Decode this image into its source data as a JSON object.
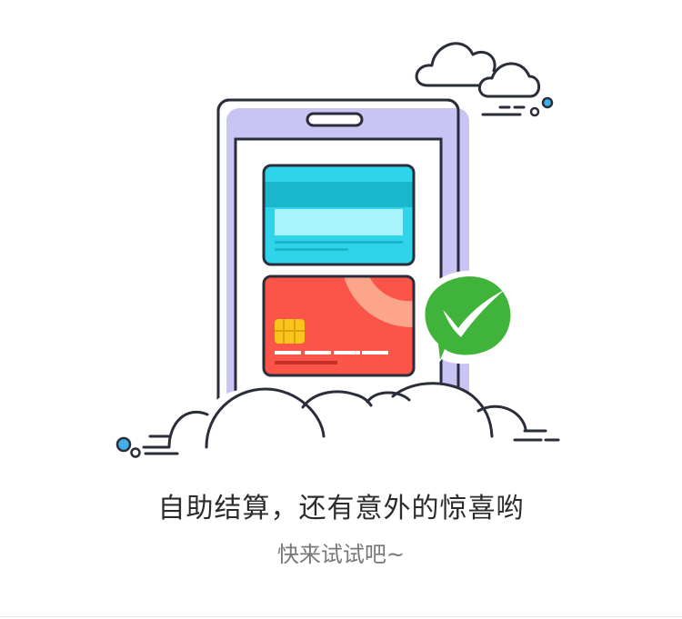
{
  "promo": {
    "headline": "自助结算，还有意外的惊喜哟",
    "subline": "快来试试吧~"
  },
  "colors": {
    "outline": "#2a2d3a",
    "phone_frame": "#c8c4f4",
    "card_cyan": "#2fd4ea",
    "card_cyan_stripe": "#1ab7cc",
    "card_cyan_panel": "#a8f4fc",
    "card_red": "#fb5448",
    "card_red_arc": "#fca58a",
    "chip": "#f7c51b",
    "wechat_green": "#3fb33a",
    "dot_blue": "#42b0e8",
    "headline_text": "#2b2b2b",
    "subline_text": "#777777"
  },
  "icons": [
    "smartphone-icon",
    "bank-card-icon",
    "credit-card-icon",
    "wechat-pay-icon",
    "cloud-icon"
  ]
}
